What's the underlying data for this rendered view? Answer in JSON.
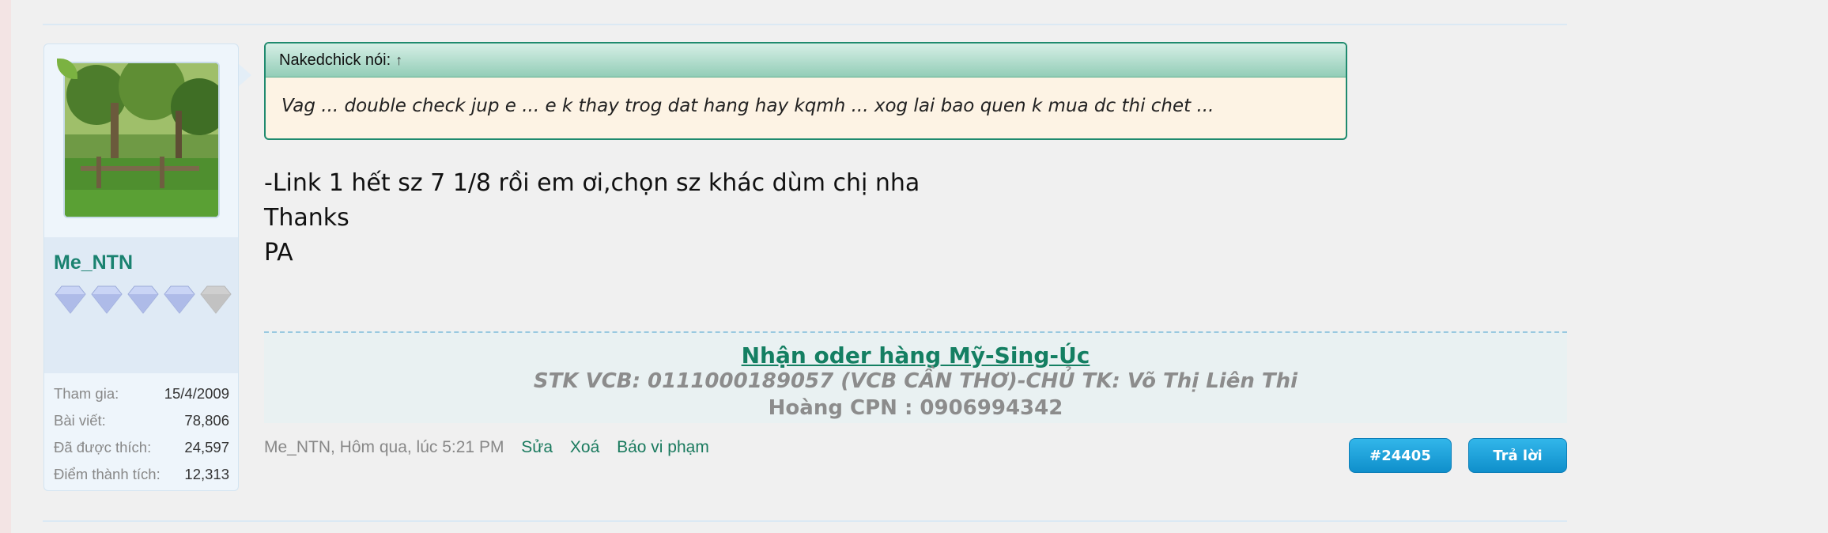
{
  "user": {
    "name": "Me_NTN",
    "avatar_icon": "leaf-badge-icon",
    "rank_gems": 5,
    "stats": [
      {
        "label": "Tham gia:",
        "value": "15/4/2009"
      },
      {
        "label": "Bài viết:",
        "value": "78,806"
      },
      {
        "label": "Đã được thích:",
        "value": "24,597"
      },
      {
        "label": "Điểm thành tích:",
        "value": "12,313"
      }
    ]
  },
  "quote": {
    "author": "Nakedchick nói:",
    "arrow": "↑",
    "text": "Vag ... double check jup e ... e k thay trog dat hang hay kqmh ... xog lai bao quen k mua dc thi chet ..."
  },
  "message": {
    "lines": [
      "-Link 1 hết sz 7 1/8 rồi em ơi,chọn sz khác dùm chị nha",
      "Thanks",
      "PA"
    ]
  },
  "signature": {
    "line1": "Nhận oder hàng Mỹ-Sing-Úc",
    "line2": "STK VCB: 0111000189057 (VCB CẦN THƠ)-CHỦ TK: Võ Thị Liên Thi",
    "line3": "Hoàng CPN : 0906994342"
  },
  "footer": {
    "meta": "Me_NTN, Hôm qua, lúc 5:21 PM",
    "edit": "Sửa",
    "delete": "Xoá",
    "report": "Báo vi phạm",
    "post_number": "#24405",
    "reply": "Trả lời"
  },
  "colors": {
    "accent_green": "#1a8270",
    "button_blue": "#1a9fd8",
    "quote_border": "#1f8a6e"
  }
}
